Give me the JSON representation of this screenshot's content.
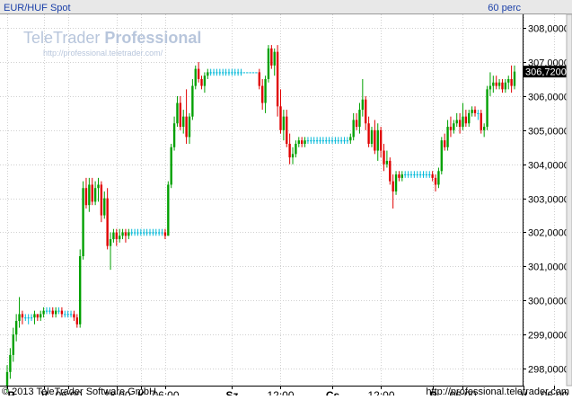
{
  "header": {
    "instrument": "EUR/HUF Spot",
    "interval": "60 perc"
  },
  "watermark": {
    "brand_regular": "TeleTrader ",
    "brand_bold": "Professional",
    "url": "http://professional.teletrader.com/"
  },
  "footer": {
    "copyright": "© 2013 TeleTrader Software GmbH",
    "url": "http://professional.teletrader.com"
  },
  "colors": {
    "up": "#00a000",
    "down": "#e00000",
    "flat": "#00b8d8",
    "grid": "#d0d0d0",
    "header_bg": "#e8e8e8",
    "last_price_bg": "#000000"
  },
  "chart_data": {
    "type": "candlestick",
    "title": "EUR/HUF Spot",
    "interval": "60 perc",
    "grid": true,
    "ylim": [
      297.5,
      308.4
    ],
    "y_ticks": [
      {
        "value": 298,
        "label": "298,0000"
      },
      {
        "value": 299,
        "label": "299,0000"
      },
      {
        "value": 300,
        "label": "300,0000"
      },
      {
        "value": 301,
        "label": "301,0000"
      },
      {
        "value": 302,
        "label": "302,0000"
      },
      {
        "value": 303,
        "label": "303,0000"
      },
      {
        "value": 304,
        "label": "304,0000"
      },
      {
        "value": 305,
        "label": "305,0000"
      },
      {
        "value": 306,
        "label": "306,0000"
      },
      {
        "value": 307,
        "label": "307,0000"
      },
      {
        "value": 308,
        "label": "308,0000"
      }
    ],
    "last_price": {
      "value": 306.72,
      "label": "306,7200"
    },
    "x_ticks": [
      {
        "index": 0,
        "label": "P"
      },
      {
        "index": 12,
        "label": "V"
      },
      {
        "index": 20,
        "label": "06:00"
      },
      {
        "index": 36,
        "label": "18:00"
      },
      {
        "index": 44,
        "label": "K"
      },
      {
        "index": 52,
        "label": "06:00"
      },
      {
        "index": 74,
        "label": "Sz"
      },
      {
        "index": 90,
        "label": "12:00"
      },
      {
        "index": 107,
        "label": "Cs"
      },
      {
        "index": 123,
        "label": "12:00"
      },
      {
        "index": 140,
        "label": "P"
      },
      {
        "index": 150,
        "label": "06:00"
      },
      {
        "index": 170,
        "label": "V"
      },
      {
        "index": 180,
        "label": "06:00"
      }
    ],
    "candles": [
      [
        297.5,
        298.1,
        297.3,
        297.9
      ],
      [
        297.9,
        298.6,
        297.7,
        298.4
      ],
      [
        298.4,
        299.2,
        298.2,
        299.0
      ],
      [
        299.0,
        299.6,
        298.8,
        299.4
      ],
      [
        299.4,
        300.1,
        299.2,
        299.6
      ],
      [
        299.6,
        299.7,
        299.3,
        299.5
      ],
      [
        299.5,
        299.6,
        299.4,
        299.5
      ],
      [
        299.5,
        299.6,
        299.3,
        299.5
      ],
      [
        299.5,
        299.6,
        299.4,
        299.5
      ],
      [
        299.5,
        299.7,
        299.3,
        299.6
      ],
      [
        299.6,
        299.6,
        299.4,
        299.5
      ],
      [
        299.5,
        299.7,
        299.4,
        299.6
      ],
      [
        299.6,
        299.8,
        299.5,
        299.7
      ],
      [
        299.7,
        299.8,
        299.6,
        299.7
      ],
      [
        299.7,
        299.8,
        299.6,
        299.7
      ],
      [
        299.7,
        299.8,
        299.5,
        299.6
      ],
      [
        299.6,
        299.8,
        299.5,
        299.7
      ],
      [
        299.7,
        299.8,
        299.6,
        299.7
      ],
      [
        299.7,
        299.8,
        299.5,
        299.6
      ],
      [
        299.6,
        299.7,
        299.5,
        299.6
      ],
      [
        299.6,
        299.7,
        299.5,
        299.6
      ],
      [
        299.6,
        299.7,
        299.5,
        299.6
      ],
      [
        299.6,
        299.7,
        299.4,
        299.5
      ],
      [
        299.5,
        299.6,
        299.2,
        299.3
      ],
      [
        299.3,
        301.5,
        299.2,
        301.3
      ],
      [
        301.3,
        303.5,
        301.2,
        303.3
      ],
      [
        303.3,
        303.6,
        302.7,
        302.8
      ],
      [
        302.8,
        303.6,
        302.6,
        303.4
      ],
      [
        303.4,
        303.6,
        302.8,
        302.9
      ],
      [
        302.9,
        303.5,
        302.8,
        303.3
      ],
      [
        303.3,
        303.6,
        302.9,
        303.4
      ],
      [
        303.4,
        303.5,
        302.3,
        302.5
      ],
      [
        302.5,
        303.2,
        302.4,
        303.0
      ],
      [
        303.0,
        303.3,
        301.5,
        301.6
      ],
      [
        301.6,
        302.0,
        300.9,
        301.8
      ],
      [
        301.8,
        302.1,
        301.7,
        302.0
      ],
      [
        302.0,
        302.1,
        301.6,
        301.8
      ],
      [
        301.8,
        302.1,
        301.7,
        301.9
      ],
      [
        301.9,
        302.1,
        301.8,
        302.0
      ],
      [
        302.0,
        302.1,
        301.7,
        301.9
      ],
      [
        301.9,
        302.1,
        301.8,
        302.0
      ],
      [
        302.0,
        302.1,
        301.9,
        302.0
      ],
      [
        302.0,
        302.1,
        301.9,
        302.0
      ],
      [
        302.0,
        302.1,
        301.9,
        302.0
      ],
      [
        302.0,
        302.1,
        301.9,
        302.0
      ],
      [
        302.0,
        302.1,
        301.9,
        302.0
      ],
      [
        302.0,
        302.1,
        301.9,
        302.0
      ],
      [
        302.0,
        302.1,
        301.9,
        302.0
      ],
      [
        302.0,
        302.1,
        301.9,
        302.0
      ],
      [
        302.0,
        302.1,
        301.9,
        302.0
      ],
      [
        302.0,
        302.1,
        301.9,
        302.0
      ],
      [
        302.0,
        302.1,
        301.9,
        302.0
      ],
      [
        302.0,
        302.1,
        301.8,
        301.9
      ],
      [
        301.9,
        303.5,
        301.9,
        303.4
      ],
      [
        303.4,
        304.6,
        303.3,
        304.5
      ],
      [
        304.5,
        305.4,
        304.4,
        305.2
      ],
      [
        305.2,
        306.0,
        305.1,
        305.8
      ],
      [
        305.8,
        306.0,
        305.0,
        305.1
      ],
      [
        305.1,
        305.6,
        304.9,
        305.4
      ],
      [
        305.4,
        306.2,
        304.6,
        304.8
      ],
      [
        304.8,
        305.5,
        304.6,
        305.4
      ],
      [
        305.4,
        306.5,
        305.3,
        306.3
      ],
      [
        306.3,
        306.9,
        306.2,
        306.8
      ],
      [
        306.8,
        307.0,
        306.4,
        306.5
      ],
      [
        306.5,
        306.6,
        306.2,
        306.3
      ],
      [
        306.3,
        306.7,
        306.1,
        306.6
      ],
      [
        306.6,
        306.8,
        306.5,
        306.7
      ],
      [
        306.7,
        306.8,
        306.6,
        306.7
      ],
      [
        306.7,
        306.8,
        306.6,
        306.7
      ],
      [
        306.7,
        306.8,
        306.6,
        306.7
      ],
      [
        306.7,
        306.8,
        306.6,
        306.7
      ],
      [
        306.7,
        306.8,
        306.6,
        306.7
      ],
      [
        306.7,
        306.8,
        306.6,
        306.7
      ],
      [
        306.7,
        306.8,
        306.6,
        306.7
      ],
      [
        306.7,
        306.8,
        306.6,
        306.7
      ],
      [
        306.7,
        306.8,
        306.6,
        306.7
      ],
      [
        306.7,
        306.8,
        306.6,
        306.7
      ],
      [
        306.7,
        306.8,
        306.6,
        306.7
      ],
      [
        306.7,
        306.7,
        306.7,
        306.7
      ],
      [
        306.7,
        306.7,
        306.7,
        306.7
      ],
      [
        306.7,
        306.7,
        306.7,
        306.7
      ],
      [
        306.7,
        306.7,
        306.7,
        306.7
      ],
      [
        306.7,
        306.7,
        306.7,
        306.7
      ],
      [
        306.7,
        306.8,
        306.2,
        306.3
      ],
      [
        306.3,
        306.5,
        305.6,
        305.8
      ],
      [
        305.8,
        306.6,
        305.5,
        306.5
      ],
      [
        306.5,
        307.5,
        306.4,
        307.4
      ],
      [
        307.4,
        307.5,
        306.8,
        306.9
      ],
      [
        306.9,
        307.4,
        306.6,
        307.3
      ],
      [
        307.3,
        307.5,
        305.4,
        305.7
      ],
      [
        305.7,
        306.2,
        304.9,
        305.0
      ],
      [
        305.0,
        305.6,
        304.7,
        305.4
      ],
      [
        305.4,
        305.6,
        304.5,
        304.6
      ],
      [
        304.6,
        304.9,
        304.0,
        304.2
      ],
      [
        304.2,
        304.5,
        304.0,
        304.3
      ],
      [
        304.3,
        304.7,
        304.2,
        304.6
      ],
      [
        304.6,
        304.8,
        304.5,
        304.7
      ],
      [
        304.7,
        304.8,
        304.5,
        304.6
      ],
      [
        304.6,
        304.8,
        304.5,
        304.7
      ],
      [
        304.7,
        304.8,
        304.6,
        304.7
      ],
      [
        304.7,
        304.8,
        304.6,
        304.7
      ],
      [
        304.7,
        304.8,
        304.6,
        304.7
      ],
      [
        304.7,
        304.8,
        304.6,
        304.7
      ],
      [
        304.7,
        304.8,
        304.6,
        304.7
      ],
      [
        304.7,
        304.8,
        304.6,
        304.7
      ],
      [
        304.7,
        304.8,
        304.6,
        304.7
      ],
      [
        304.7,
        304.8,
        304.6,
        304.7
      ],
      [
        304.7,
        304.8,
        304.6,
        304.7
      ],
      [
        304.7,
        304.8,
        304.6,
        304.7
      ],
      [
        304.7,
        304.8,
        304.6,
        304.7
      ],
      [
        304.7,
        304.8,
        304.6,
        304.7
      ],
      [
        304.7,
        304.8,
        304.6,
        304.7
      ],
      [
        304.7,
        304.8,
        304.6,
        304.7
      ],
      [
        304.7,
        304.9,
        304.6,
        304.8
      ],
      [
        304.8,
        305.5,
        304.7,
        305.3
      ],
      [
        305.3,
        305.5,
        305.0,
        305.1
      ],
      [
        305.1,
        305.8,
        304.9,
        305.6
      ],
      [
        305.6,
        306.5,
        305.4,
        305.9
      ],
      [
        305.9,
        306.0,
        305.0,
        305.2
      ],
      [
        305.2,
        305.4,
        304.5,
        304.6
      ],
      [
        304.6,
        305.1,
        304.5,
        305.0
      ],
      [
        305.0,
        305.3,
        304.3,
        304.4
      ],
      [
        304.4,
        305.2,
        304.1,
        305.0
      ],
      [
        305.0,
        305.1,
        304.2,
        304.4
      ],
      [
        304.4,
        304.6,
        303.8,
        304.0
      ],
      [
        304.0,
        304.4,
        303.9,
        304.1
      ],
      [
        304.1,
        304.2,
        303.4,
        303.5
      ],
      [
        303.5,
        303.7,
        302.7,
        303.2
      ],
      [
        303.2,
        303.8,
        303.1,
        303.7
      ],
      [
        303.7,
        303.8,
        303.5,
        303.6
      ],
      [
        303.6,
        303.8,
        303.5,
        303.7
      ],
      [
        303.7,
        303.8,
        303.6,
        303.7
      ],
      [
        303.7,
        303.8,
        303.6,
        303.7
      ],
      [
        303.7,
        303.8,
        303.6,
        303.7
      ],
      [
        303.7,
        303.8,
        303.6,
        303.7
      ],
      [
        303.7,
        303.8,
        303.6,
        303.7
      ],
      [
        303.7,
        303.8,
        303.6,
        303.7
      ],
      [
        303.7,
        303.8,
        303.6,
        303.7
      ],
      [
        303.7,
        303.8,
        303.6,
        303.7
      ],
      [
        303.7,
        303.8,
        303.6,
        303.7
      ],
      [
        303.7,
        303.8,
        303.5,
        303.6
      ],
      [
        303.6,
        303.7,
        303.2,
        303.4
      ],
      [
        303.4,
        303.9,
        303.3,
        303.8
      ],
      [
        303.8,
        304.8,
        303.7,
        304.7
      ],
      [
        304.7,
        304.9,
        304.4,
        304.5
      ],
      [
        304.5,
        305.3,
        304.4,
        305.1
      ],
      [
        305.1,
        305.4,
        304.8,
        305.0
      ],
      [
        305.0,
        305.3,
        304.9,
        305.2
      ],
      [
        305.2,
        305.5,
        305.1,
        305.3
      ],
      [
        305.3,
        305.5,
        304.9,
        305.1
      ],
      [
        305.1,
        305.8,
        305.0,
        305.4
      ],
      [
        305.4,
        305.6,
        305.1,
        305.2
      ],
      [
        305.2,
        305.6,
        305.1,
        305.5
      ],
      [
        305.5,
        305.7,
        305.4,
        305.6
      ],
      [
        305.6,
        305.7,
        305.4,
        305.5
      ],
      [
        305.5,
        305.6,
        305.3,
        305.5
      ],
      [
        305.5,
        305.6,
        304.9,
        305.0
      ],
      [
        305.0,
        305.2,
        304.8,
        305.1
      ],
      [
        305.1,
        306.3,
        305.0,
        306.2
      ],
      [
        306.2,
        306.7,
        306.0,
        306.3
      ],
      [
        306.3,
        306.6,
        306.1,
        306.4
      ],
      [
        306.4,
        306.6,
        306.2,
        306.3
      ],
      [
        306.3,
        306.5,
        306.2,
        306.4
      ],
      [
        306.4,
        306.5,
        306.1,
        306.2
      ],
      [
        306.2,
        306.5,
        306.1,
        306.4
      ],
      [
        306.4,
        306.6,
        306.2,
        306.5
      ],
      [
        306.5,
        306.9,
        306.1,
        306.3
      ],
      [
        306.3,
        306.9,
        306.2,
        306.72
      ]
    ]
  }
}
